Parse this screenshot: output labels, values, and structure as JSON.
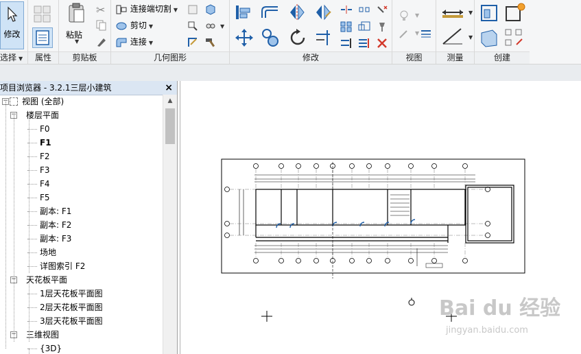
{
  "ribbon": {
    "panels": {
      "select": "选择",
      "properties": "属性",
      "clipboard": "剪贴板",
      "geometry": "几何图形",
      "modify": "修改",
      "view": "视图",
      "measure": "测量",
      "create": "创建"
    },
    "modify_button": "修改",
    "paste_button": "粘贴",
    "cope_label": "连接端切割",
    "cut_label": "剪切",
    "join_label": "连接"
  },
  "browser": {
    "title": "项目浏览器 - 3.2.1三层小建筑",
    "close": "×",
    "tree": [
      {
        "label": "视图 (全部)",
        "level": 0,
        "toggle": "−",
        "icon": true
      },
      {
        "label": "楼层平面",
        "level": 1,
        "toggle": "−"
      },
      {
        "label": "F0",
        "level": 2
      },
      {
        "label": "F1",
        "level": 2,
        "bold": true
      },
      {
        "label": "F2",
        "level": 2
      },
      {
        "label": "F3",
        "level": 2
      },
      {
        "label": "F4",
        "level": 2
      },
      {
        "label": "F5",
        "level": 2
      },
      {
        "label": "副本: F1",
        "level": 2
      },
      {
        "label": "副本: F2",
        "level": 2
      },
      {
        "label": "副本: F3",
        "level": 2
      },
      {
        "label": "场地",
        "level": 2
      },
      {
        "label": "详图索引 F2",
        "level": 2
      },
      {
        "label": "天花板平面",
        "level": 1,
        "toggle": "−"
      },
      {
        "label": "1层天花板平面图",
        "level": 2
      },
      {
        "label": "2层天花板平面图",
        "level": 2
      },
      {
        "label": "3层天花板平面图",
        "level": 2
      },
      {
        "label": "三维视图",
        "level": 1,
        "toggle": "−"
      },
      {
        "label": "{3D}",
        "level": 2
      }
    ]
  },
  "watermark": {
    "brand": "Bai du 经验",
    "url": "jingyan.baidu.com"
  },
  "colors": {
    "title_bar": "#dbe6f3",
    "modify_active": "#cfe3f6",
    "icon_blue": "#1f5fa8",
    "icon_red": "#d33a2c"
  }
}
